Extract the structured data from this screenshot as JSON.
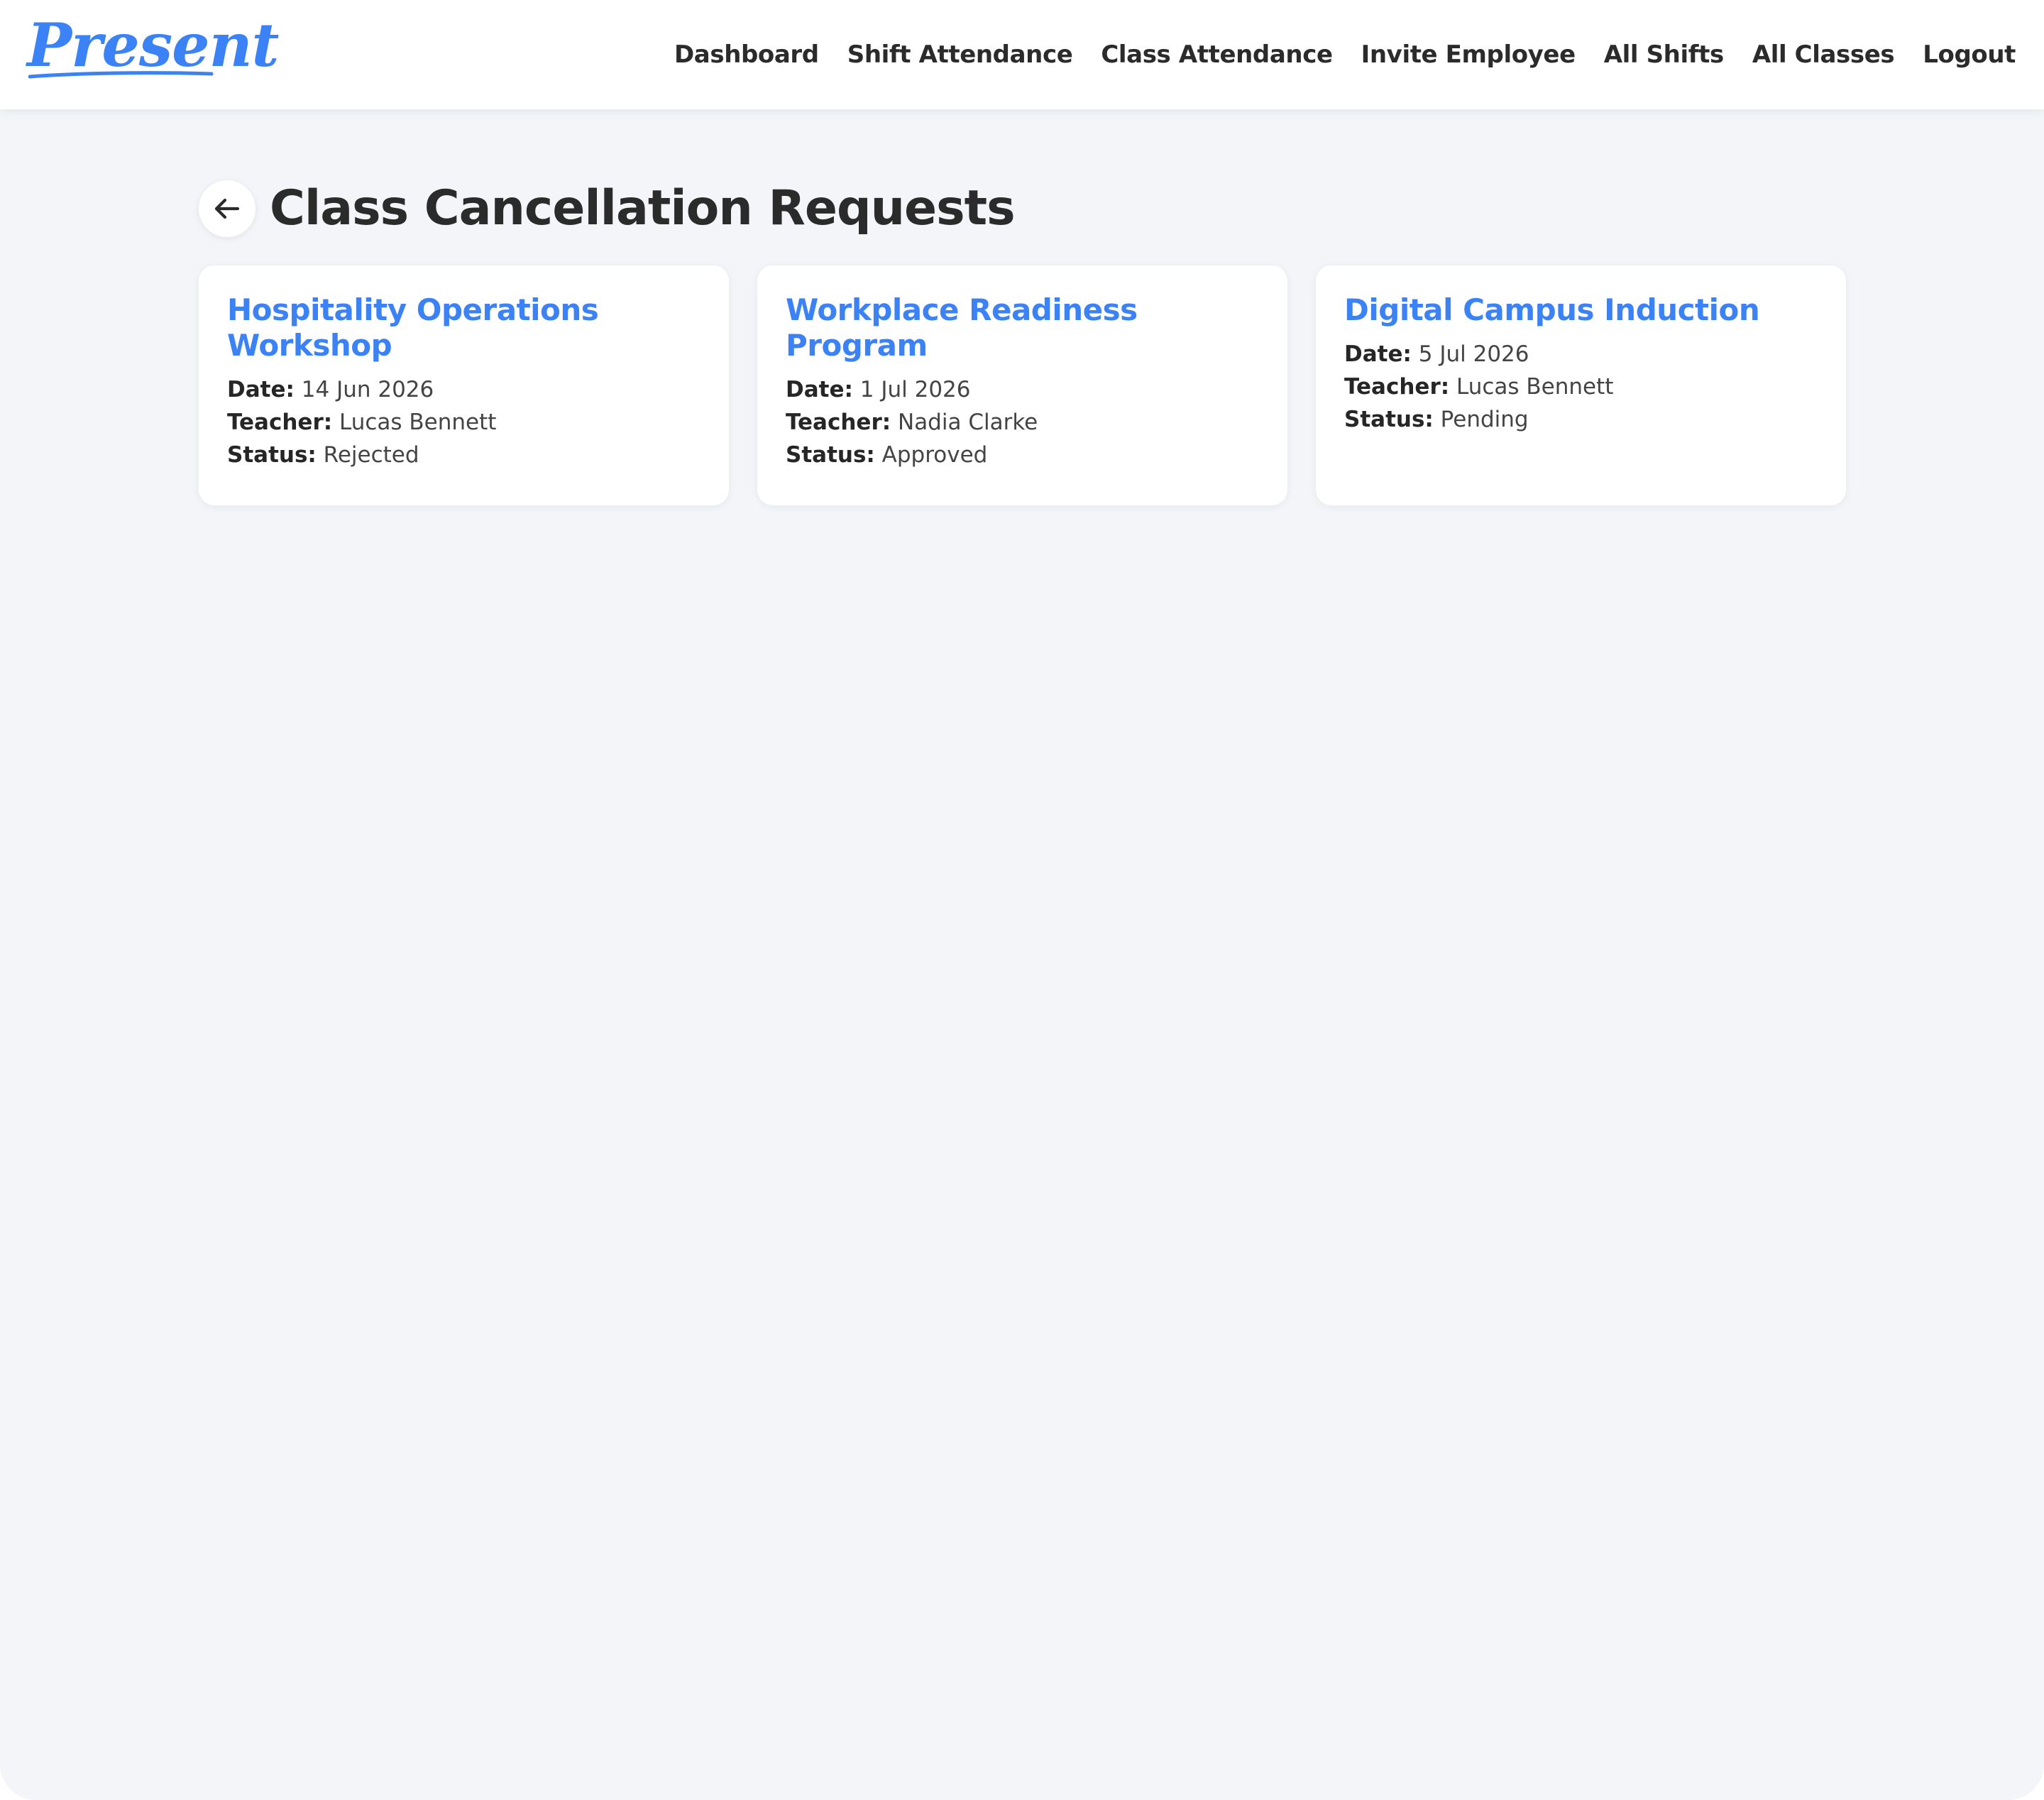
{
  "app": {
    "logo_text": "Present",
    "accent_color": "#3b82f6",
    "text_color": "#2b2b2b",
    "page_background": "#f3f5f9"
  },
  "nav": {
    "items": [
      "Dashboard",
      "Shift Attendance",
      "Class Attendance",
      "Invite Employee",
      "All Shifts",
      "All Classes",
      "Logout"
    ]
  },
  "page": {
    "title": "Class Cancellation Requests",
    "back_icon": "arrow-left-icon"
  },
  "labels": {
    "date": "Date:",
    "teacher": "Teacher:",
    "status": "Status:"
  },
  "requests": [
    {
      "title": "Hospitality Operations Workshop",
      "date": "14 Jun 2026",
      "teacher": "Lucas Bennett",
      "status": "Rejected"
    },
    {
      "title": "Workplace Readiness Program",
      "date": "1 Jul 2026",
      "teacher": "Nadia Clarke",
      "status": "Approved"
    },
    {
      "title": "Digital Campus Induction",
      "date": "5 Jul 2026",
      "teacher": "Lucas Bennett",
      "status": "Pending"
    }
  ]
}
